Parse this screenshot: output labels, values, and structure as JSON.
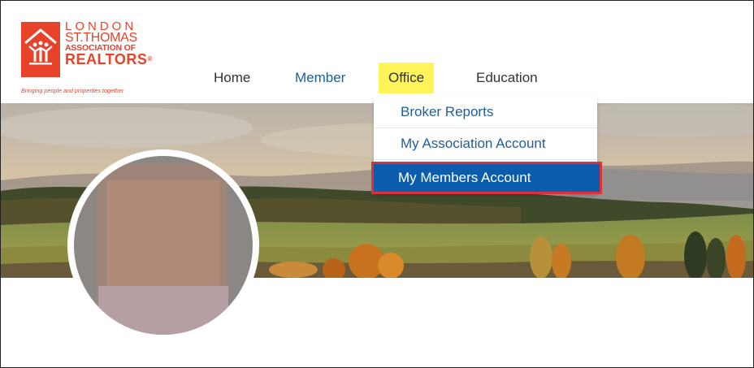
{
  "logo": {
    "line1": "LONDON",
    "line2": "ST.THOMAS",
    "line3": "ASSOCIATION OF",
    "line4": "REALTORS",
    "registered_mark": "®",
    "tagline": "Bringing people and properties together",
    "brand_color": "#e8422a"
  },
  "nav": {
    "items": [
      {
        "label": "Home"
      },
      {
        "label": "Member"
      },
      {
        "label": "Office"
      },
      {
        "label": "Education"
      }
    ],
    "active": "Office",
    "highlight_color": "#fff55a",
    "link_color": "#1f5e9a"
  },
  "dropdown": {
    "items": [
      {
        "label": "Broker Reports"
      },
      {
        "label": "My Association Account"
      },
      {
        "label": "My Members Account"
      }
    ],
    "selected": "My Members Account",
    "selected_bg": "#0b5cad",
    "selected_border": "#d9323a"
  },
  "profile": {
    "avatar_icon": "blurred-profile-photo"
  }
}
